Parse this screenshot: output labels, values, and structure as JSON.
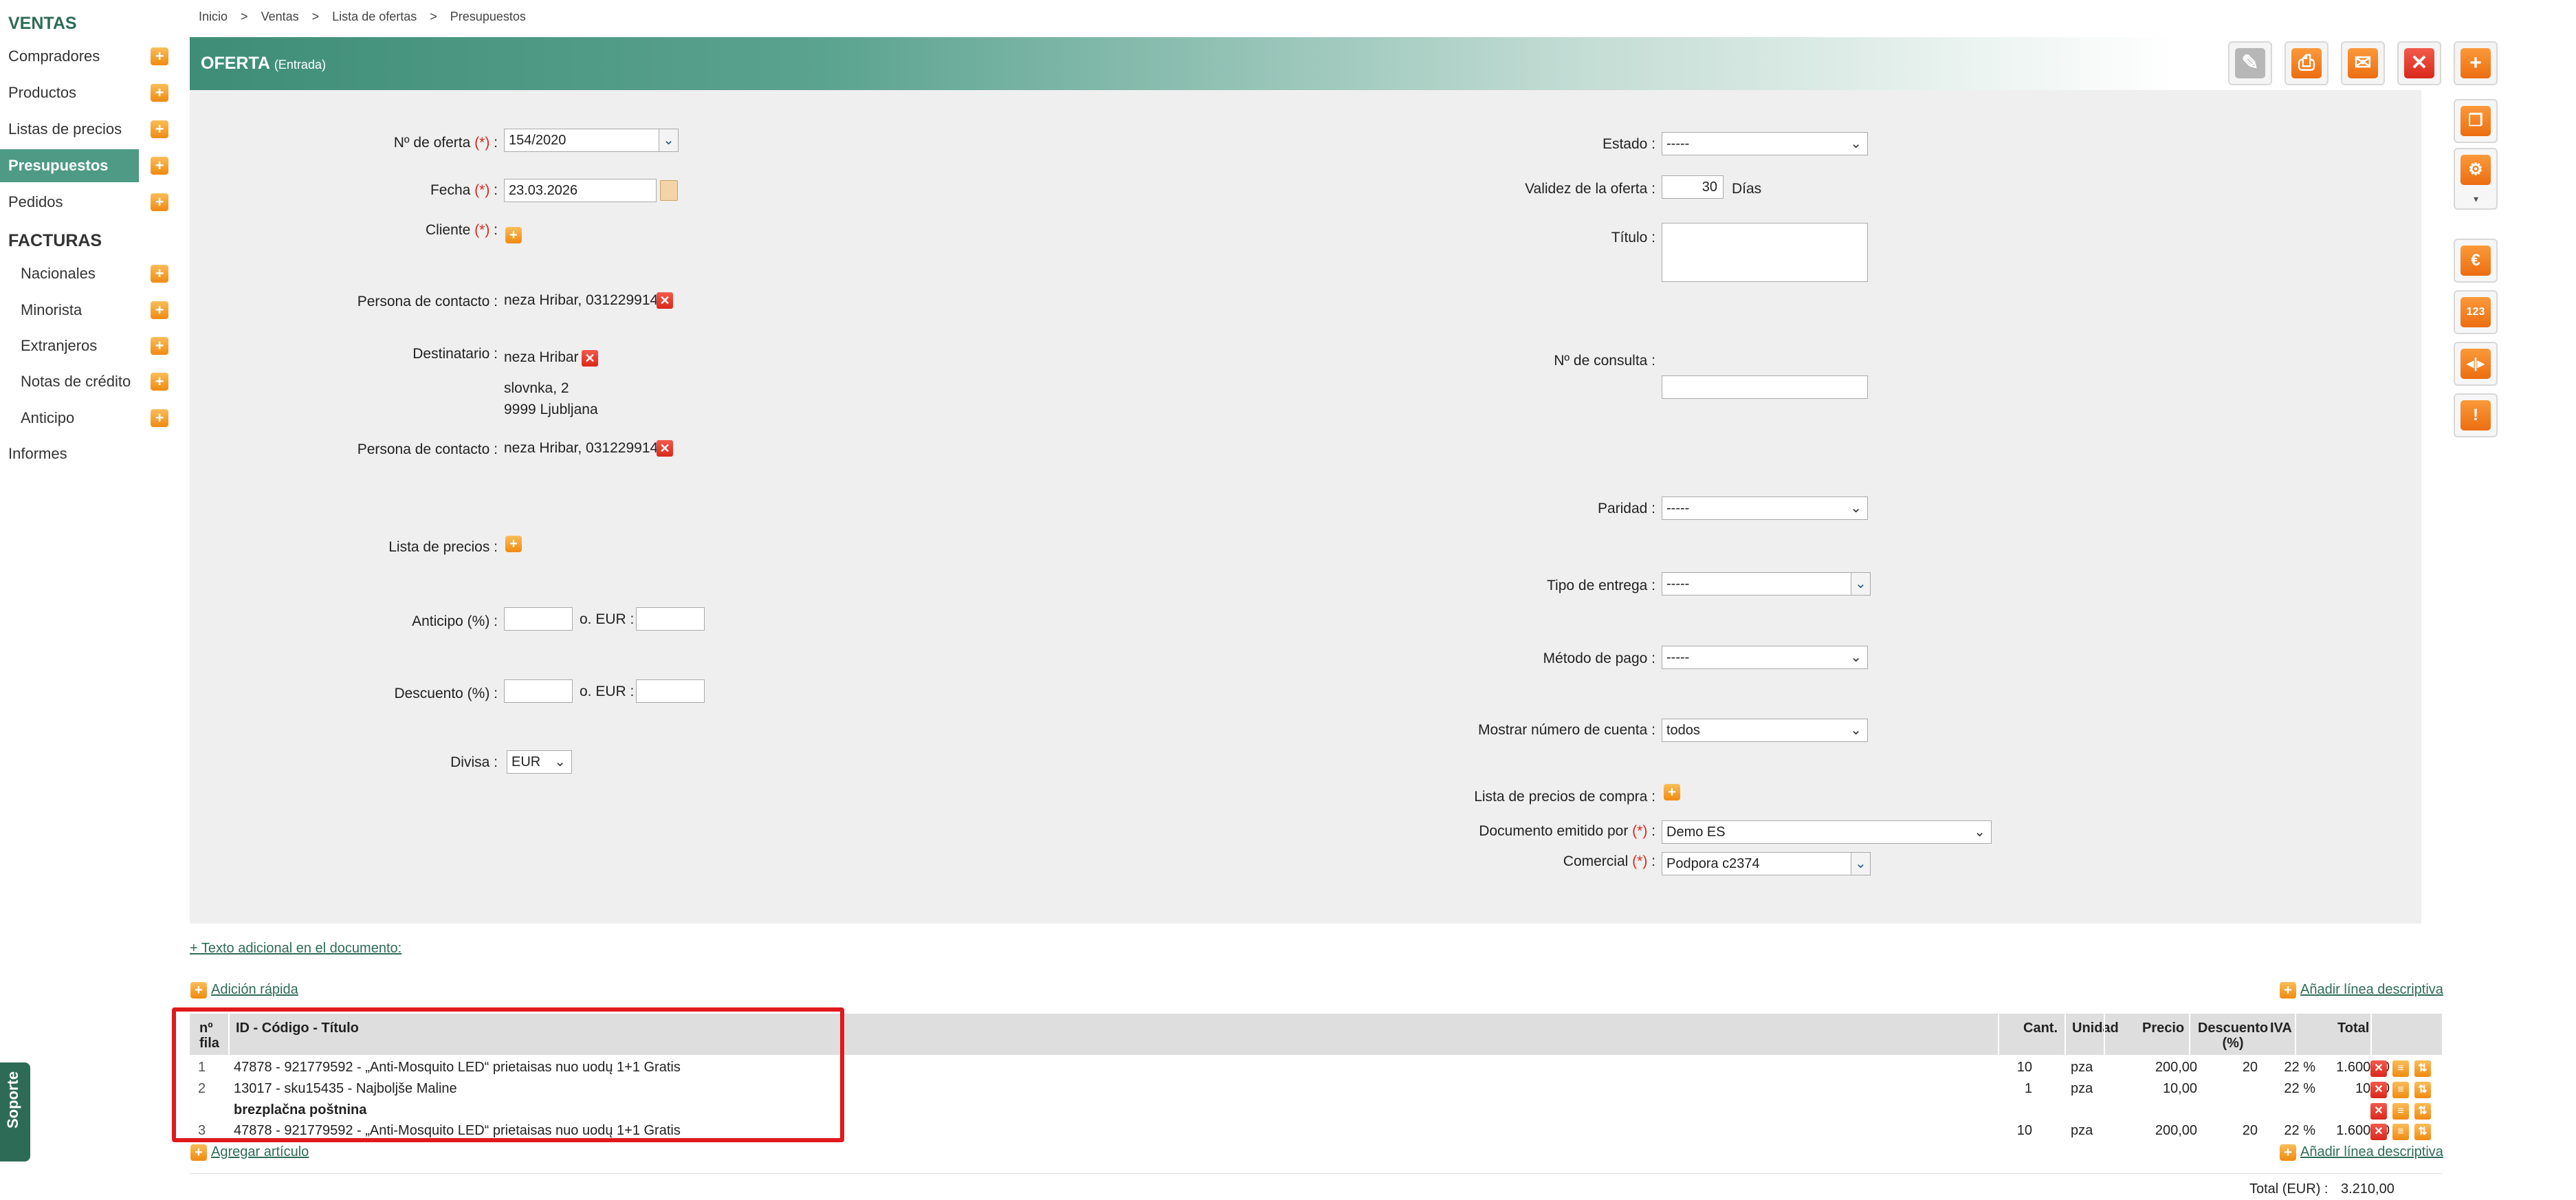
{
  "sidebar": {
    "sections": [
      "VENTAS",
      "FACTURAS"
    ],
    "ventas_items": [
      "Compradores",
      "Productos",
      "Listas de precios",
      "Presupuestos",
      "Pedidos"
    ],
    "facturas_items": [
      "Nacionales",
      "Minorista",
      "Extranjeros",
      "Notas de crédito",
      "Anticipo"
    ],
    "informes": "Informes",
    "plus": "+"
  },
  "breadcrumb": [
    "Inicio",
    ">",
    "Ventas",
    ">",
    "Lista de ofertas",
    ">",
    "Presupuestos"
  ],
  "header": {
    "title": "OFERTA",
    "subtitle": "(Entrada)"
  },
  "form": {
    "req": "(*)",
    "offer_no_label": "Nº de oferta",
    "offer_no_value": "154/2020",
    "date_label": "Fecha",
    "date_value": "23.03.2026",
    "client_label": "Cliente",
    "contact_label": "Persona de contacto :",
    "contact_value": "neza Hribar, 031229914",
    "recipient_label": "Destinatario :",
    "recipient_name": "neza Hribar",
    "recipient_street": "slovnka, 2",
    "recipient_city": "9999 Ljubljana",
    "contact2_label": "Persona de contacto :",
    "contact2_value": "neza Hribar, 031229914",
    "pricelist_label": "Lista de precios :",
    "advance_label": "Anticipo (%) :",
    "or_eur": "o. EUR :",
    "discount_label": "Descuento (%) :",
    "currency_label": "Divisa :",
    "currency_value": "EUR",
    "status_label": "Estado :",
    "status_value": "-----",
    "validity_label": "Validez de la oferta :",
    "validity_value": "30",
    "validity_unit": "Días",
    "title_label": "Título :",
    "inquiry_label": "Nº de consulta :",
    "parity_label": "Paridad :",
    "parity_value": "-----",
    "delivery_label": "Tipo de entrega :",
    "delivery_value": "-----",
    "payment_label": "Método de pago :",
    "payment_value": "-----",
    "account_label": "Mostrar número de cuenta :",
    "account_value": "todos",
    "purchase_pricelist_label": "Lista de precios de compra :",
    "issued_by_label": "Documento emitido por",
    "issued_by_value": "Demo ES",
    "sales_label": "Comercial",
    "sales_value": "Podpora c2374"
  },
  "links": {
    "additional_text": "+ Texto adicional en el documento:",
    "quick_add": "Adición rápida",
    "add_desc_line": "Añadir línea descriptiva",
    "add_item": "Agregar artículo"
  },
  "table": {
    "headers": {
      "row_no": "nº fila",
      "id_code_title": "ID - Código - Título",
      "qty": "Cant.",
      "unit": "Unidad",
      "price": "Precio",
      "discount": "Descuento (%)",
      "vat": "IVA",
      "total": "Total"
    },
    "rows": [
      {
        "no": "1",
        "desc": "47878 - 921779592 - „Anti-Mosquito LED“ prietaisas nuo uodų 1+1 Gratis",
        "qty": "10",
        "unit": "pza",
        "price": "200,00",
        "discount": "20",
        "vat": "22 %",
        "total": "1.600,00"
      },
      {
        "no": "2",
        "desc": "13017 - sku15435 - Najboljše Maline",
        "qty": "1",
        "unit": "pza",
        "price": "10,00",
        "discount": "",
        "vat": "22 %",
        "total": "10,00"
      },
      {
        "no": "",
        "desc": "brezplačna poštnina",
        "qty": "",
        "unit": "",
        "price": "",
        "discount": "",
        "vat": "",
        "total": ""
      },
      {
        "no": "3",
        "desc": "47878 - 921779592 - „Anti-Mosquito LED“ prietaisas nuo uodų 1+1 Gratis",
        "qty": "10",
        "unit": "pza",
        "price": "200,00",
        "discount": "20",
        "vat": "22 %",
        "total": "1.600,00"
      }
    ],
    "total_label": "Total (EUR) :",
    "total_value": "3.210,00"
  },
  "support": "Soporte"
}
